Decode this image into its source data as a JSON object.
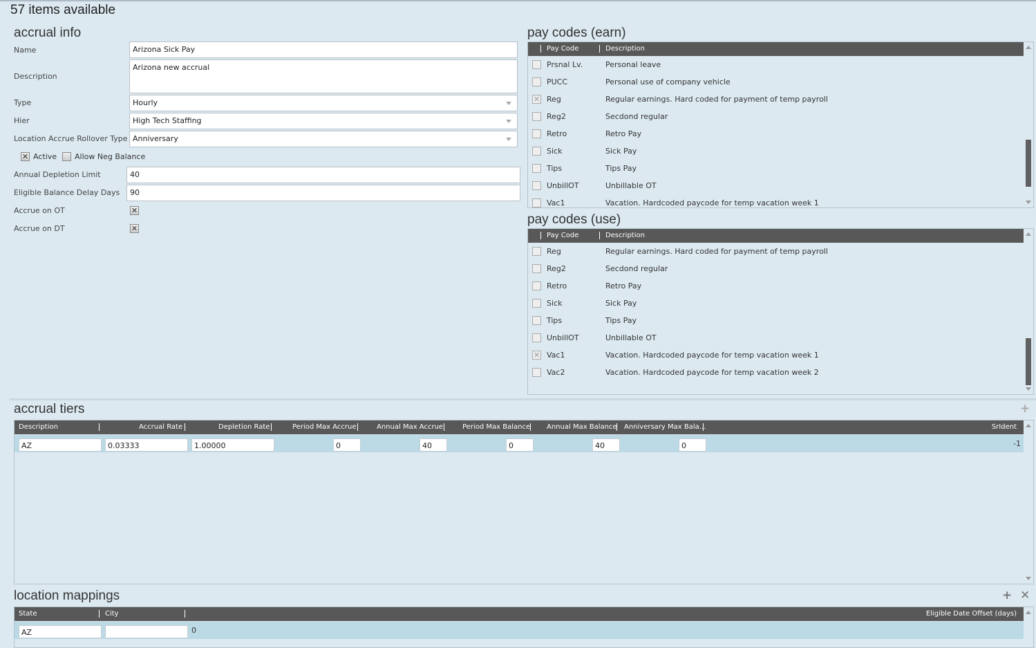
{
  "header": {
    "title": "57 items available"
  },
  "accrual_info": {
    "title": "accrual info",
    "name_label": "Name",
    "name_value": "Arizona Sick Pay",
    "description_label": "Description",
    "description_value": "Arizona new accrual",
    "type_label": "Type",
    "type_value": "Hourly",
    "hier_label": "Hier",
    "hier_value": "High Tech Staffing",
    "rollover_label": "Location Accrue Rollover Type",
    "rollover_value": "Anniversary",
    "active_label": "Active",
    "active_checked": true,
    "allow_neg_label": "Allow Neg Balance",
    "allow_neg_checked": false,
    "annual_depletion_label": "Annual Depletion Limit",
    "annual_depletion_value": "40",
    "eligible_delay_label": "Eligible Balance Delay Days",
    "eligible_delay_value": "90",
    "accrue_ot_label": "Accrue on OT",
    "accrue_ot_checked": true,
    "accrue_dt_label": "Accrue on DT",
    "accrue_dt_checked": true
  },
  "pay_codes_earn": {
    "title": "pay codes (earn)",
    "columns": [
      "Pay Code",
      "Description"
    ],
    "rows": [
      {
        "code": "Prsnal Lv.",
        "description": "Personal leave",
        "checked": false
      },
      {
        "code": "PUCC",
        "description": "Personal use of company vehicle",
        "checked": false
      },
      {
        "code": "Reg",
        "description": "Regular earnings.  Hard coded for payment of temp payroll",
        "checked": true
      },
      {
        "code": "Reg2",
        "description": "Secdond regular",
        "checked": false
      },
      {
        "code": "Retro",
        "description": "Retro Pay",
        "checked": false
      },
      {
        "code": "Sick",
        "description": "Sick Pay",
        "checked": false
      },
      {
        "code": "Tips",
        "description": "Tips Pay",
        "checked": false
      },
      {
        "code": "UnbillOT",
        "description": "Unbillable OT",
        "checked": false
      },
      {
        "code": "Vac1",
        "description": "Vacation. Hardcoded paycode for temp vacation week 1",
        "checked": false
      }
    ]
  },
  "pay_codes_use": {
    "title": "pay codes (use)",
    "columns": [
      "Pay Code",
      "Description"
    ],
    "rows": [
      {
        "code": "Reg",
        "description": "Regular earnings.  Hard coded for payment of temp payroll",
        "checked": false
      },
      {
        "code": "Reg2",
        "description": "Secdond regular",
        "checked": false
      },
      {
        "code": "Retro",
        "description": "Retro Pay",
        "checked": false
      },
      {
        "code": "Sick",
        "description": "Sick Pay",
        "checked": false
      },
      {
        "code": "Tips",
        "description": "Tips Pay",
        "checked": false
      },
      {
        "code": "UnbillOT",
        "description": "Unbillable OT",
        "checked": false
      },
      {
        "code": "Vac1",
        "description": "Vacation. Hardcoded paycode for temp vacation week 1",
        "checked": true
      },
      {
        "code": "Vac2",
        "description": "Vacation. Hardcoded paycode for temp vacation week 2",
        "checked": false
      }
    ]
  },
  "accrual_tiers": {
    "title": "accrual tiers",
    "add_icon": "plus-icon",
    "columns": [
      "Description",
      "Accrual Rate",
      "Depletion Rate",
      "Period Max Accrue",
      "Annual Max Accrue",
      "Period Max Balance",
      "Annual Max Balance",
      "Anniversary Max Bala...",
      "SrIdent"
    ],
    "rows": [
      {
        "description": "AZ",
        "accrual_rate": "0.03333",
        "depletion_rate": "1.00000",
        "period_max_accrue": "0",
        "annual_max_accrue": "40",
        "period_max_balance": "0",
        "annual_max_balance": "40",
        "anniversary_max_balance": "0",
        "srident": "-1"
      }
    ]
  },
  "location_mappings": {
    "title": "location mappings",
    "add_icon": "plus-icon",
    "delete_icon": "close-icon",
    "columns": [
      "State",
      "City",
      "Eligible Date Offset (days)"
    ],
    "rows": [
      {
        "state": "AZ",
        "city": "",
        "offset": "0"
      }
    ]
  }
}
